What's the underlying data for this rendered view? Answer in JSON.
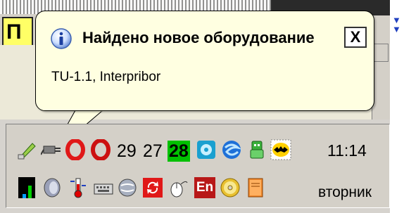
{
  "background": {
    "tab_label": "П"
  },
  "balloon": {
    "title": "Найдено новое оборудование",
    "text": "TU-1.1, Interpribor",
    "close_label": "X",
    "info_icon": "info-icon"
  },
  "tray": {
    "row1": [
      {
        "type": "icon",
        "name": "usb-pen-icon"
      },
      {
        "type": "icon",
        "name": "plug-icon"
      },
      {
        "type": "icon",
        "name": "opera-icon"
      },
      {
        "type": "icon",
        "name": "opera-icon-2"
      },
      {
        "type": "text",
        "value": "29"
      },
      {
        "type": "text",
        "value": "27"
      },
      {
        "type": "text",
        "value": "28",
        "highlight": true
      },
      {
        "type": "icon",
        "name": "disc-app-icon"
      },
      {
        "type": "icon",
        "name": "swirl-icon"
      },
      {
        "type": "icon",
        "name": "robot-icon"
      },
      {
        "type": "icon",
        "name": "bat-icon"
      }
    ],
    "row2": [
      {
        "type": "icon",
        "name": "cpu-meter-icon"
      },
      {
        "type": "icon",
        "name": "sound-icon"
      },
      {
        "type": "icon",
        "name": "thermometer-icon"
      },
      {
        "type": "icon",
        "name": "keyboard-icon"
      },
      {
        "type": "icon",
        "name": "globe-icon"
      },
      {
        "type": "icon",
        "name": "refresh-icon"
      },
      {
        "type": "icon",
        "name": "mouse-icon"
      },
      {
        "type": "icon",
        "name": "language-icon",
        "label": "En"
      },
      {
        "type": "icon",
        "name": "cd-icon"
      },
      {
        "type": "icon",
        "name": "book-icon"
      }
    ],
    "clock": "11:14",
    "day": "вторник"
  }
}
